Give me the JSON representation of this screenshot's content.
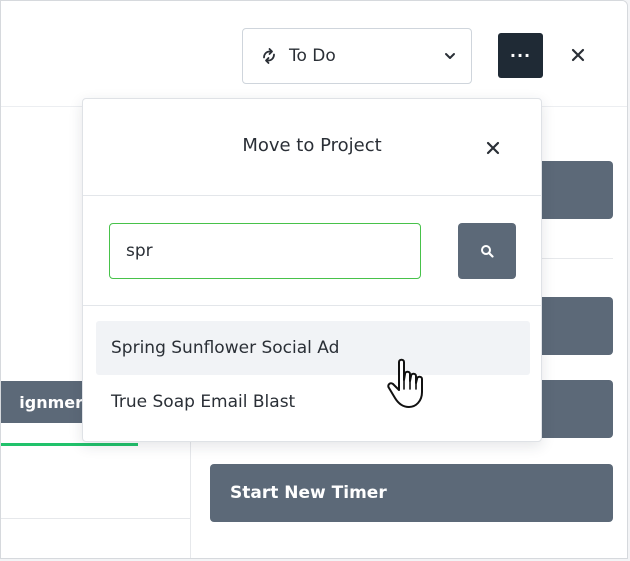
{
  "header": {
    "status_label": "To Do",
    "more_label": "···"
  },
  "left": {
    "tab_label": "ignmer"
  },
  "side_buttons": {
    "start_timer_label": "Start New Timer"
  },
  "popover": {
    "title": "Move to Project",
    "search_value": "spr",
    "results": [
      {
        "label": "Spring Sunflower Social Ad"
      },
      {
        "label": "True Soap Email Blast"
      }
    ]
  },
  "colors": {
    "accent_green": "#47c24a",
    "button_slate": "#5c6978",
    "dark_button": "#1f2a35"
  }
}
